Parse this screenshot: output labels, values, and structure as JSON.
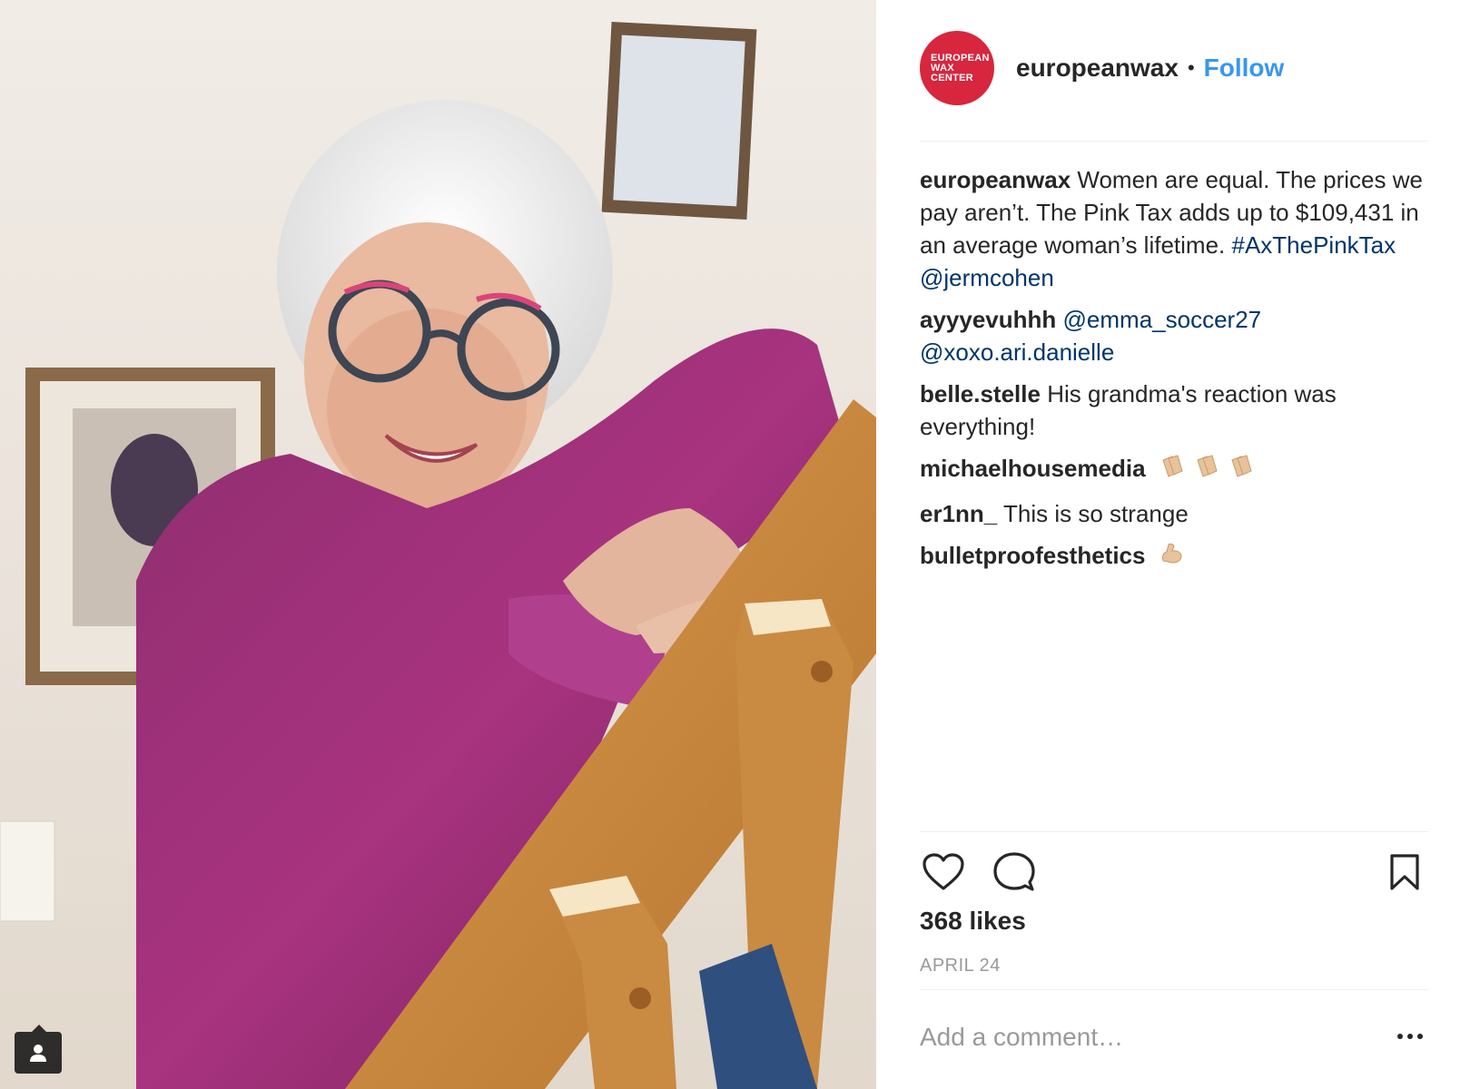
{
  "post": {
    "account": {
      "username": "europeanwax",
      "avatar_text": [
        "EUROPEAN",
        "WAX",
        "CENTER"
      ],
      "separator": "•",
      "follow_label": "Follow"
    },
    "caption": {
      "user": "europeanwax",
      "text": "Women are equal. The prices we pay aren’t. The Pink Tax adds up to $109,431 in an average woman’s lifetime.",
      "links": [
        "#AxThePinkTax",
        "@jermcohen"
      ]
    },
    "comments": [
      {
        "user": "ayyyevuhhh",
        "links": [
          "@emma_soccer27",
          "@xoxo.ari.danielle"
        ]
      },
      {
        "user": "belle.stelle",
        "text": "His grandma's reaction was everything!"
      },
      {
        "user": "michaelhousemedia",
        "emoji": "clapping-hands x3"
      },
      {
        "user": "er1nn_",
        "text": "This is so strange"
      },
      {
        "user": "bulletproofesthetics",
        "emoji": "flexed-biceps"
      }
    ],
    "likes": "368 likes",
    "date": "APRIL 24",
    "comment_placeholder": "Add a comment…",
    "colors": {
      "brand_red": "#d7263d",
      "follow_blue": "#3897f0",
      "link_navy": "#003569"
    }
  }
}
